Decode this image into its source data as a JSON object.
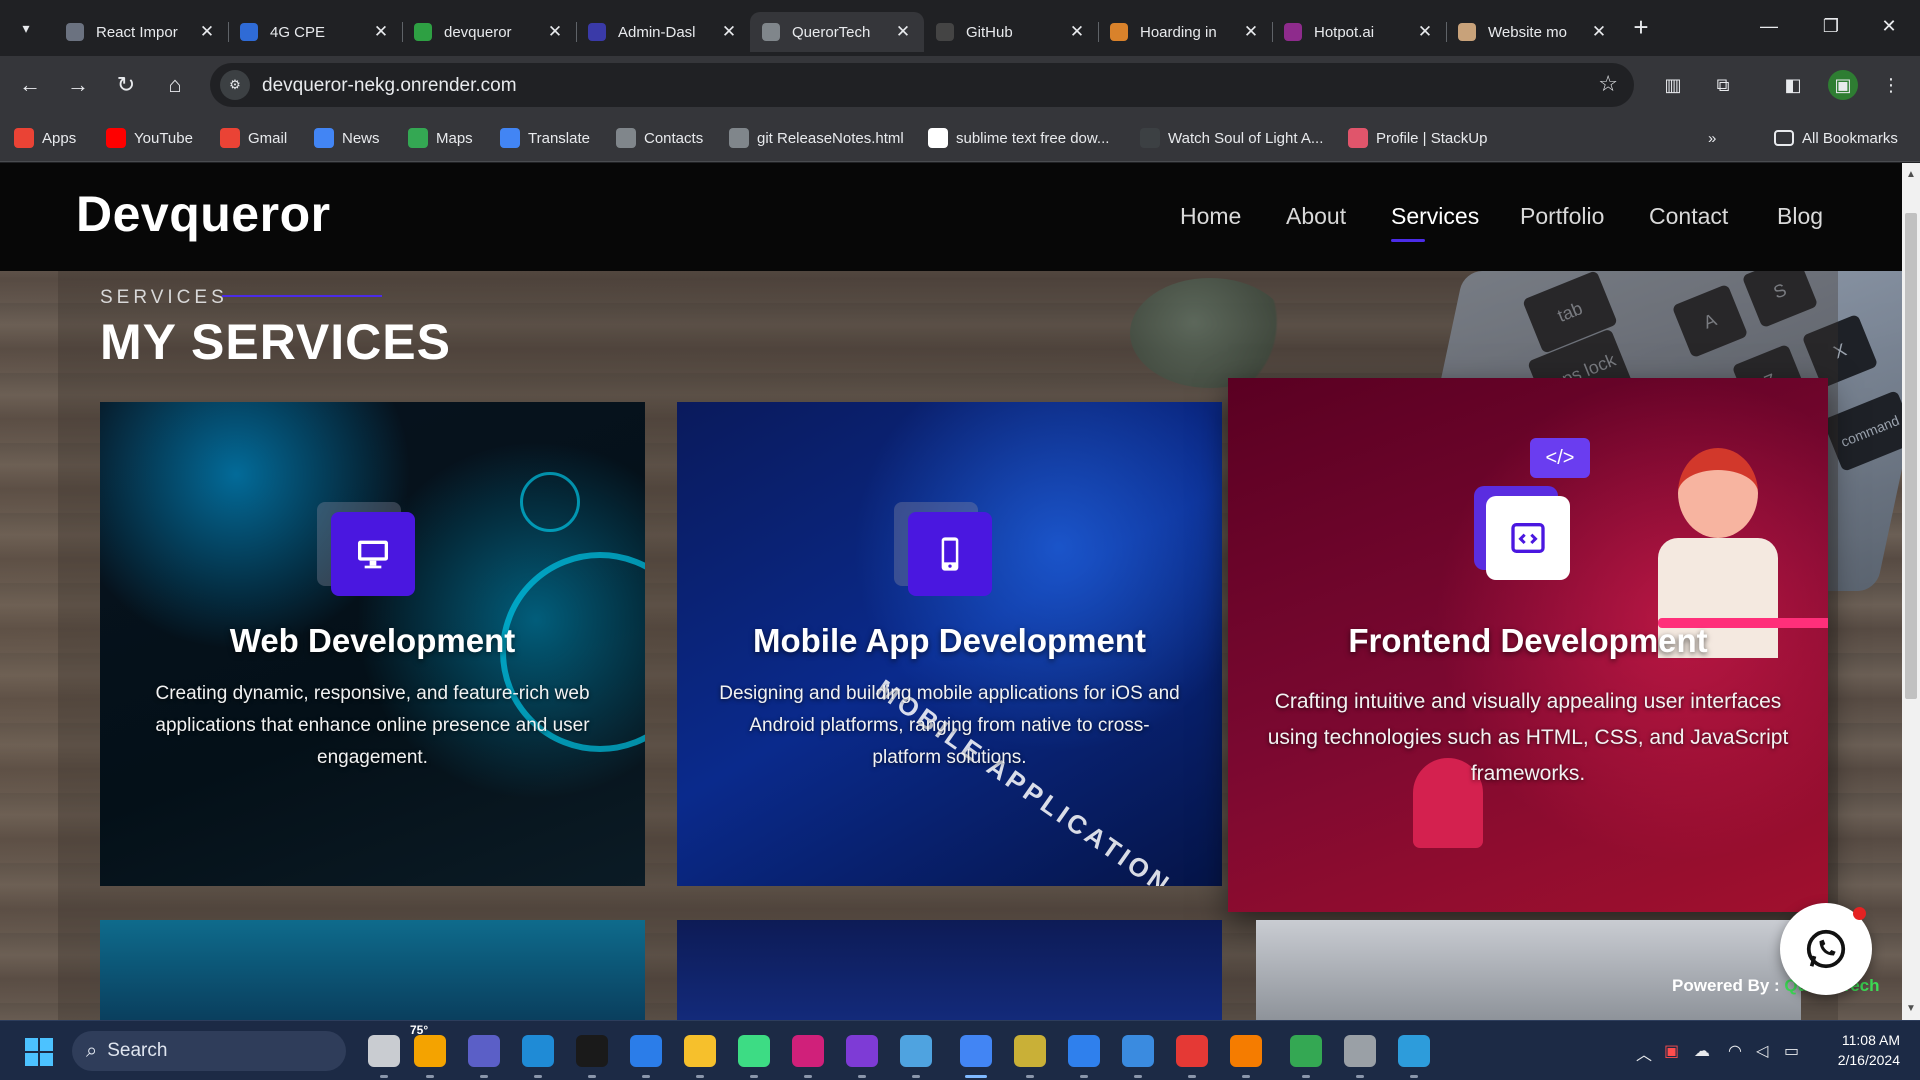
{
  "browser": {
    "tabs": [
      {
        "title": "React Impor",
        "icon": "openai-icon",
        "color": "#6b7280",
        "active": false
      },
      {
        "title": "4G CPE",
        "icon": "router-icon",
        "color": "#2f6bd6",
        "active": false
      },
      {
        "title": "devqueror",
        "icon": "render-icon",
        "color": "#2ea043",
        "active": false
      },
      {
        "title": "Admin-Dasl",
        "icon": "admin-icon",
        "color": "#3a3aa8",
        "active": false
      },
      {
        "title": "QuerorTech",
        "icon": "globe-icon",
        "color": "#80868b",
        "active": true
      },
      {
        "title": "GitHub",
        "icon": "github-icon",
        "color": "#444444",
        "active": false
      },
      {
        "title": "Hoarding in",
        "icon": "hoarding-icon",
        "color": "#d9822b",
        "active": false
      },
      {
        "title": "Hotpot.ai",
        "icon": "hotpot-icon",
        "color": "#8e2b8c",
        "active": false
      },
      {
        "title": "Website mo",
        "icon": "muscle-icon",
        "color": "#c8a27a",
        "active": false
      }
    ],
    "url": "devqueror-nekg.onrender.com",
    "bookmarks": [
      {
        "label": "Apps",
        "icon": "apps-grid-icon",
        "color": "#ea4335"
      },
      {
        "label": "YouTube",
        "icon": "youtube-icon",
        "color": "#ff0000"
      },
      {
        "label": "Gmail",
        "icon": "gmail-icon",
        "color": "#ea4335"
      },
      {
        "label": "News",
        "icon": "news-icon",
        "color": "#4285f4"
      },
      {
        "label": "Maps",
        "icon": "maps-pin-icon",
        "color": "#34a853"
      },
      {
        "label": "Translate",
        "icon": "translate-icon",
        "color": "#4285f4"
      },
      {
        "label": "Contacts",
        "icon": "globe-icon",
        "color": "#80868b"
      },
      {
        "label": "git ReleaseNotes.html",
        "icon": "globe-icon",
        "color": "#80868b"
      },
      {
        "label": "sublime text free dow...",
        "icon": "google-icon",
        "color": "#ffffff"
      },
      {
        "label": "Watch Soul of Light A...",
        "icon": "play-icon",
        "color": "#3c4043"
      },
      {
        "label": "Profile | StackUp",
        "icon": "stackup-icon",
        "color": "#e0556b"
      }
    ],
    "all_bookmarks": "All Bookmarks"
  },
  "site": {
    "logo": "Devqueror",
    "nav": [
      "Home",
      "About",
      "Services",
      "Portfolio",
      "Contact",
      "Blog"
    ],
    "active_nav": "Services",
    "section_eyebrow": "SERVICES",
    "section_title": "MY SERVICES",
    "cards": [
      {
        "title": "Web Development",
        "description": "Creating dynamic, responsive, and feature-rich web applications that enhance online presence and user engagement.",
        "icon": "monitor-icon"
      },
      {
        "title": "Mobile App Development",
        "description": "Designing and building mobile applications for iOS and Android platforms, ranging from native to cross-platform solutions.",
        "icon": "smartphone-icon",
        "image_text": "MOBILE APPLICATION"
      },
      {
        "title": "Frontend Development",
        "description": "Crafting intuitive and visually appealing user interfaces using technologies such as HTML, CSS, and JavaScript frameworks.",
        "icon": "code-window-icon",
        "image_tag": "</>"
      }
    ],
    "powered_by_label": "Powered By : ",
    "powered_by_brand": "QuerorTech",
    "laptop_keys": [
      "tab",
      "caps lock",
      "A",
      "S",
      "Z",
      "X",
      "command"
    ],
    "accent_color": "#4b2ce8"
  },
  "taskbar": {
    "search_label": "Search",
    "weather_temp": "75°",
    "time": "11:08 AM",
    "date": "2/16/2024",
    "apps": [
      "file-manager-icon",
      "weather-icon",
      "meet-icon",
      "edge-icon",
      "terminal-icon",
      "store-icon",
      "explorer-icon",
      "android-icon",
      "wamp-icon",
      "affinity-icon",
      "notepad-icon",
      "chrome-icon",
      "eclipse-icon",
      "vscode-icon",
      "settings-blue-icon",
      "snip-icon",
      "vlc-icon",
      "chrome-beta-icon",
      "settings-icon",
      "photos-icon"
    ]
  }
}
